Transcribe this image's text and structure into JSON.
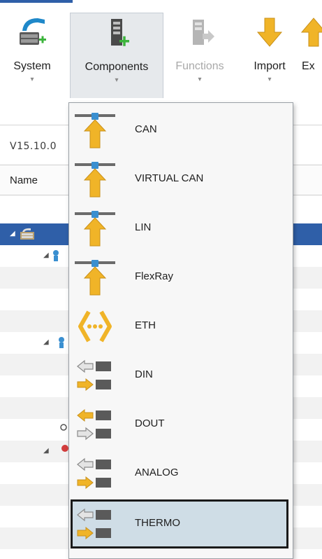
{
  "ribbon": {
    "buttons": [
      {
        "label": "System",
        "state": "normal",
        "icon": "system-add-icon"
      },
      {
        "label": "Components",
        "state": "active",
        "icon": "components-add-icon"
      },
      {
        "label": "Functions",
        "state": "disabled",
        "icon": "functions-icon"
      },
      {
        "label": "Import",
        "state": "normal",
        "icon": "import-arrow-icon"
      },
      {
        "label": "Ex",
        "state": "normal",
        "icon": "export-arrow-icon"
      }
    ],
    "dropdown_glyph": "▾"
  },
  "left_pane": {
    "version": "V15.10.0",
    "column_header": "Name",
    "tree_expand_glyph": "◢"
  },
  "components_menu": {
    "items": [
      {
        "label": "CAN",
        "icon": "can-bus-icon"
      },
      {
        "label": "VIRTUAL CAN",
        "icon": "virtual-can-bus-icon"
      },
      {
        "label": "LIN",
        "icon": "lin-bus-icon"
      },
      {
        "label": "FlexRay",
        "icon": "flexray-bus-icon"
      },
      {
        "label": "ETH",
        "icon": "ethernet-icon"
      },
      {
        "label": "DIN",
        "icon": "digital-in-icon"
      },
      {
        "label": "DOUT",
        "icon": "digital-out-icon"
      },
      {
        "label": "ANALOG",
        "icon": "analog-icon"
      },
      {
        "label": "THERMO",
        "icon": "thermo-icon"
      }
    ],
    "hovered_item": "THERMO"
  },
  "colors": {
    "accent_blue": "#2f5fa8",
    "arrow_gold": "#f0b428",
    "bus_blue": "#3a8fd0",
    "menu_hover": "#cfdde6"
  }
}
